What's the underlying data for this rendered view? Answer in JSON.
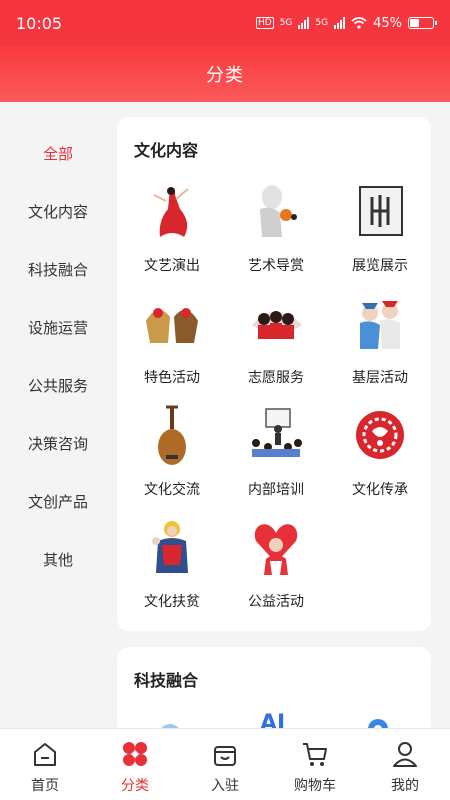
{
  "status": {
    "time": "10:05",
    "battery": "45%",
    "battery_level": 0.45,
    "net_hd": "HD",
    "net_5g_a": "5G",
    "net_5g_b": "5G"
  },
  "header": {
    "title": "分类"
  },
  "sidebar": {
    "items": [
      {
        "label": "全部",
        "active": true
      },
      {
        "label": "文化内容"
      },
      {
        "label": "科技融合"
      },
      {
        "label": "设施运营"
      },
      {
        "label": "公共服务"
      },
      {
        "label": "决策咨询"
      },
      {
        "label": "文创产品"
      },
      {
        "label": "其他"
      }
    ]
  },
  "sections": [
    {
      "title": "文化内容",
      "items": [
        {
          "label": "文艺演出",
          "icon": "dancer-icon"
        },
        {
          "label": "艺术导赏",
          "icon": "statue-icon"
        },
        {
          "label": "展览展示",
          "icon": "exhibit-icon"
        },
        {
          "label": "特色活动",
          "icon": "lion-dance-icon"
        },
        {
          "label": "志愿服务",
          "icon": "volunteers-icon"
        },
        {
          "label": "基层活动",
          "icon": "opera-icon"
        },
        {
          "label": "文化交流",
          "icon": "pipa-icon"
        },
        {
          "label": "内部培训",
          "icon": "training-icon"
        },
        {
          "label": "文化传承",
          "icon": "papercut-icon"
        },
        {
          "label": "文化扶贫",
          "icon": "folk-figures-icon"
        },
        {
          "label": "公益活动",
          "icon": "charity-heart-icon"
        }
      ]
    },
    {
      "title": "科技融合",
      "peek": [
        "ai-3d-icon",
        "ai-text-icon",
        "location-pin-icon"
      ],
      "peek_text": "AI"
    }
  ],
  "tabbar": {
    "items": [
      {
        "label": "首页",
        "icon": "home-icon"
      },
      {
        "label": "分类",
        "icon": "category-icon",
        "active": true
      },
      {
        "label": "入驻",
        "icon": "store-icon"
      },
      {
        "label": "购物车",
        "icon": "cart-icon"
      },
      {
        "label": "我的",
        "icon": "profile-icon"
      }
    ]
  },
  "colors": {
    "brand_red": "#f6363f",
    "active_text": "#e8303a",
    "background": "#f4f4f4"
  }
}
